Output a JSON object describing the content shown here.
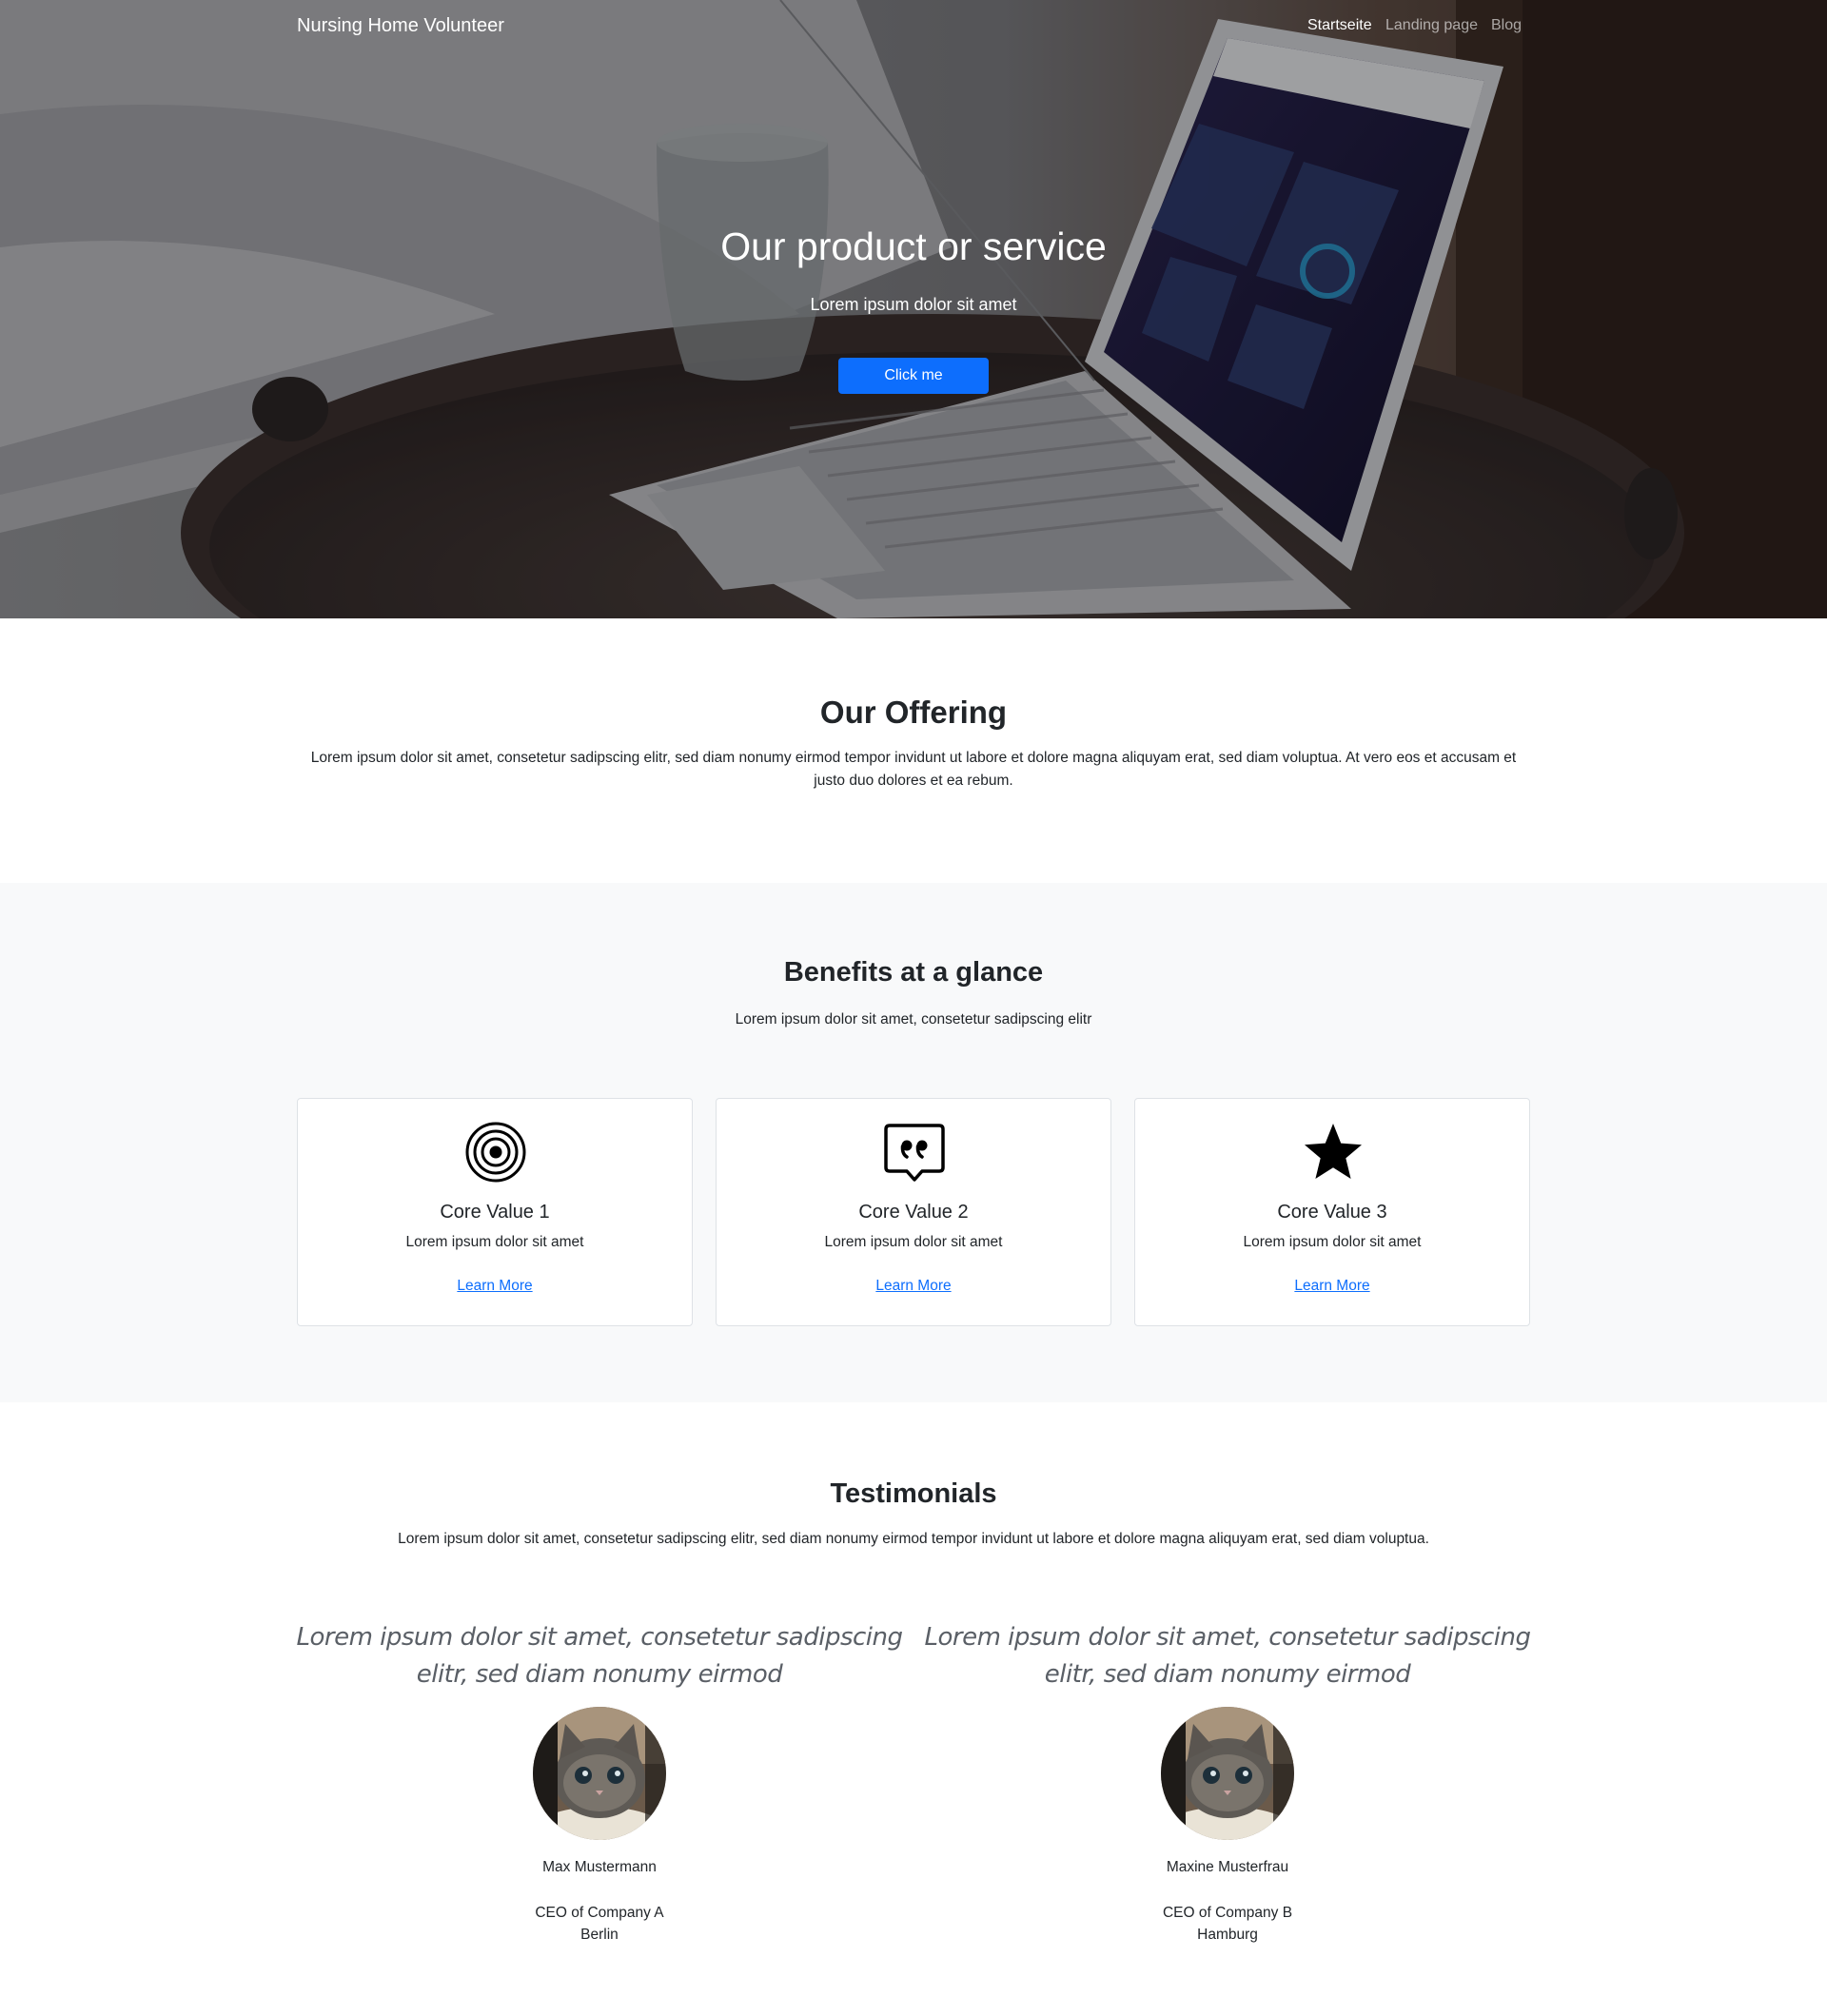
{
  "navbar": {
    "brand": "Nursing Home Volunteer",
    "links": [
      {
        "label": "Startseite",
        "active": true
      },
      {
        "label": "Landing page",
        "active": false
      },
      {
        "label": "Blog",
        "active": false
      }
    ]
  },
  "hero": {
    "title": "Our product or service",
    "subtitle": "Lorem ipsum dolor sit amet",
    "button_label": "Click me",
    "background_image": "laptop on bedside table with glass of water"
  },
  "offering": {
    "title": "Our Offering",
    "text": "Lorem ipsum dolor sit amet, consetetur sadipscing elitr, sed diam nonumy eirmod tempor invidunt ut labore et dolore magna aliquyam erat, sed diam voluptua. At vero eos et accusam et justo duo dolores et ea rebum."
  },
  "benefits": {
    "title": "Benefits at a glance",
    "subtitle": "Lorem ipsum dolor sit amet, consetetur sadipscing elitr",
    "cards": [
      {
        "icon": "bullseye-icon",
        "title": "Core Value 1",
        "text": "Lorem ipsum dolor sit amet",
        "link": "Learn More"
      },
      {
        "icon": "quote-bubble-icon",
        "title": "Core Value 2",
        "text": "Lorem ipsum dolor sit amet",
        "link": "Learn More"
      },
      {
        "icon": "star-icon",
        "title": "Core Value 3",
        "text": "Lorem ipsum dolor sit amet",
        "link": "Learn More"
      }
    ]
  },
  "testimonials": {
    "title": "Testimonials",
    "text": "Lorem ipsum dolor sit amet, consetetur sadipscing elitr, sed diam nonumy eirmod tempor invidunt ut labore et dolore magna aliquyam erat, sed diam voluptua.",
    "items": [
      {
        "quote": "Lorem ipsum dolor sit amet, consetetur sadipscing elitr, sed diam nonumy eirmod",
        "name": "Max Mustermann",
        "role": "CEO of Company A",
        "city": "Berlin",
        "avatar": "kitten-photo"
      },
      {
        "quote": "Lorem ipsum dolor sit amet, consetetur sadipscing elitr, sed diam nonumy eirmod",
        "name": "Maxine Musterfrau",
        "role": "CEO of Company B",
        "city": "Hamburg",
        "avatar": "kitten-photo"
      }
    ]
  },
  "colors": {
    "primary": "#0d6efd",
    "light_section": "#f8f9fa",
    "text": "#212529"
  }
}
